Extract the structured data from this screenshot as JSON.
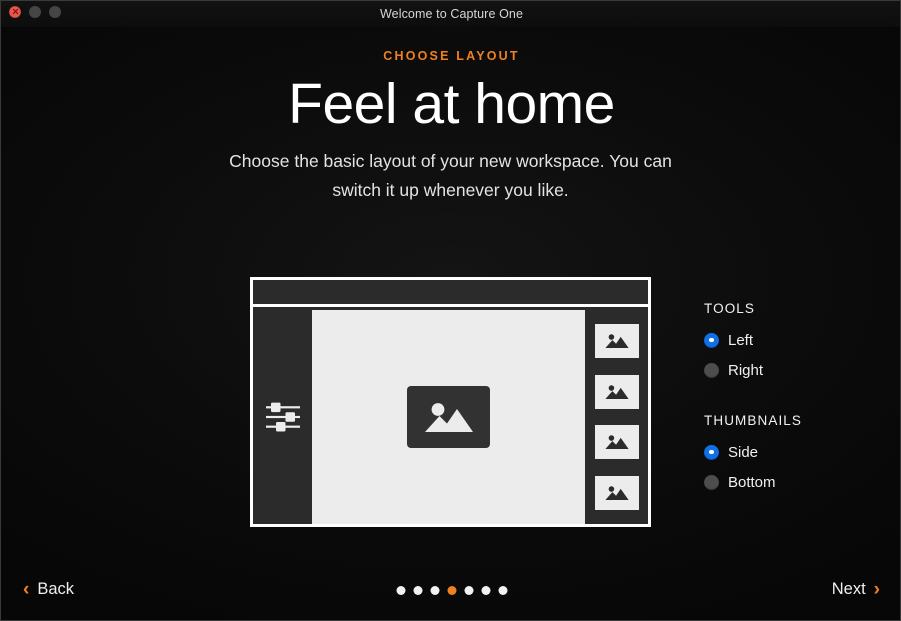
{
  "window": {
    "title": "Welcome to Capture One",
    "traffic_lights": [
      {
        "name": "close",
        "color": "#e8574b",
        "enabled": true
      },
      {
        "name": "minimize",
        "color": "#454545",
        "enabled": false
      },
      {
        "name": "maximize",
        "color": "#454545",
        "enabled": false
      }
    ]
  },
  "header": {
    "eyebrow": "CHOOSE LAYOUT",
    "eyebrow_color": "#f08020",
    "headline": "Feel at home",
    "subtitle": "Choose the basic layout of your new workspace. You can switch it up whenever you like."
  },
  "preview": {
    "tools_position": "left",
    "thumbnails_position": "side",
    "thumbnail_count": 4,
    "slider_count": 3,
    "panel_color": "#2b2b2b",
    "canvas_color": "#ececec",
    "border_color": "#ffffff"
  },
  "options": {
    "groups": [
      {
        "label": "TOOLS",
        "items": [
          {
            "label": "Left",
            "selected": true
          },
          {
            "label": "Right",
            "selected": false
          }
        ]
      },
      {
        "label": "THUMBNAILS",
        "items": [
          {
            "label": "Side",
            "selected": true
          },
          {
            "label": "Bottom",
            "selected": false
          }
        ]
      }
    ],
    "selected_color": "#1070e8",
    "unselected_color": "#4d4d4d"
  },
  "footer": {
    "back_label": "Back",
    "next_label": "Next",
    "back_chevron": "‹",
    "next_chevron": "›",
    "accent_color": "#f08020",
    "pagination": {
      "total": 7,
      "active_index": 3
    }
  }
}
